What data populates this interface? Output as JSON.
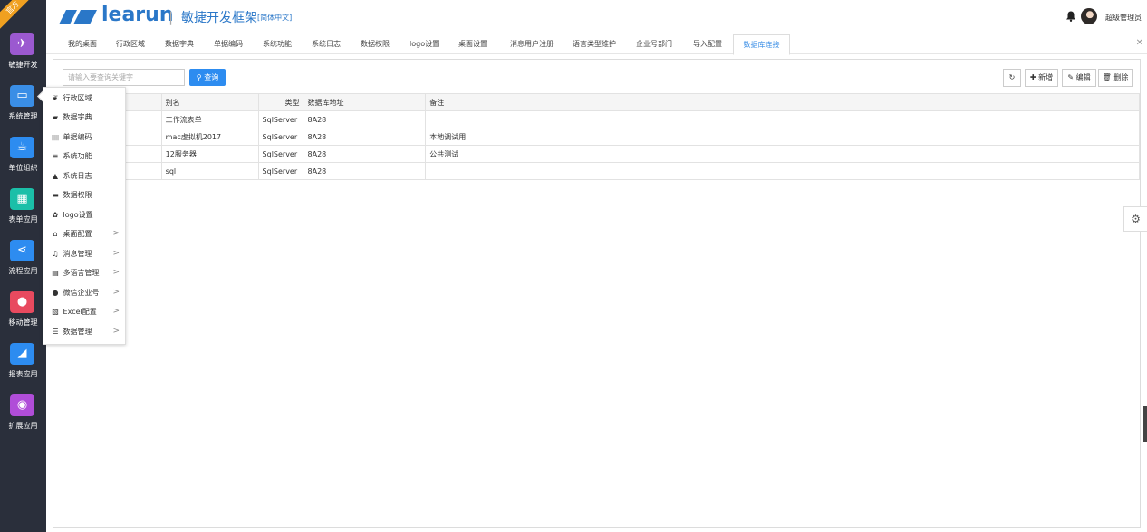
{
  "sidebar": {
    "ribbon": "官方",
    "items": [
      {
        "label": "敏捷开发",
        "icon": "paper-plane-icon",
        "glyph": "✈",
        "color": "#9b59d0"
      },
      {
        "label": "系统管理",
        "icon": "monitor-icon",
        "glyph": "▭",
        "color": "#3a8ee6"
      },
      {
        "label": "单位组织",
        "icon": "coffee-cup-icon",
        "glyph": "☕",
        "color": "#2d8cf0"
      },
      {
        "label": "表单应用",
        "icon": "table-icon",
        "glyph": "▦",
        "color": "#1bbfa8"
      },
      {
        "label": "流程应用",
        "icon": "share-icon",
        "glyph": "⋖",
        "color": "#2d8cf0"
      },
      {
        "label": "移动管理",
        "icon": "android-icon",
        "glyph": "●",
        "color": "#e84a5f"
      },
      {
        "label": "报表应用",
        "icon": "area-chart-icon",
        "glyph": "◢",
        "color": "#2d8cf0"
      },
      {
        "label": "扩展应用",
        "icon": "globe-icon",
        "glyph": "◉",
        "color": "#b04dd8"
      }
    ]
  },
  "header": {
    "logo_text": "learun",
    "separator": "|",
    "subtitle": "敏捷开发框架",
    "lang": "[简体中文]",
    "username": "超级管理员"
  },
  "tabs": {
    "items": [
      "我的桌面",
      "行政区域",
      "数据字典",
      "单据编码",
      "系统功能",
      "系统日志",
      "数据权限",
      "logo设置",
      "桌面设置",
      "消息用户注册",
      "语言类型维护",
      "企业号部门",
      "导入配置",
      "数据库连接"
    ],
    "active": "数据库连接",
    "close": "✕"
  },
  "toolbar": {
    "search_placeholder": "请输入要查询关键字",
    "search_label": "查询",
    "refresh_icon": "↻",
    "add_label": "新增",
    "edit_label": "编辑",
    "delete_label": "删除"
  },
  "table": {
    "headers": [
      "别名",
      "类型",
      "数据库地址",
      "备注"
    ],
    "rows": [
      [
        "工作流表单",
        "SqlServer",
        "8A28",
        ""
      ],
      [
        "mac虚拟机2017",
        "SqlServer",
        "8A28",
        "本地调试用"
      ],
      [
        "12服务器",
        "SqlServer",
        "8A28",
        "公共测试"
      ],
      [
        "sql",
        "SqlServer",
        "8A28",
        ""
      ]
    ]
  },
  "submenu": {
    "items": [
      {
        "label": "行政区域",
        "icon": "leaf-icon",
        "glyph": "❦",
        "arrow": ""
      },
      {
        "label": "数据字典",
        "icon": "book-icon",
        "glyph": "▰",
        "arrow": ""
      },
      {
        "label": "单据编码",
        "icon": "barcode-icon",
        "glyph": "||||",
        "arrow": ""
      },
      {
        "label": "系统功能",
        "icon": "list-icon",
        "glyph": "≡",
        "arrow": ""
      },
      {
        "label": "系统日志",
        "icon": "warning-icon",
        "glyph": "▲",
        "arrow": ""
      },
      {
        "label": "数据权限",
        "icon": "briefcase-icon",
        "glyph": "▬",
        "arrow": ""
      },
      {
        "label": "logo设置",
        "icon": "cog-icon",
        "glyph": "✿",
        "arrow": ""
      },
      {
        "label": "桌面配置",
        "icon": "home-icon",
        "glyph": "⌂",
        "arrow": ">"
      },
      {
        "label": "消息管理",
        "icon": "bell-outline-icon",
        "glyph": "♫",
        "arrow": ">"
      },
      {
        "label": "多语言管理",
        "icon": "document-icon",
        "glyph": "▤",
        "arrow": ">"
      },
      {
        "label": "微信企业号",
        "icon": "wechat-icon",
        "glyph": "●",
        "arrow": ">"
      },
      {
        "label": "Excel配置",
        "icon": "file-excel-icon",
        "glyph": "▧",
        "arrow": ">"
      },
      {
        "label": "数据管理",
        "icon": "database-icon",
        "glyph": "☰",
        "arrow": ">"
      }
    ]
  },
  "settings_glyph": "⚙"
}
